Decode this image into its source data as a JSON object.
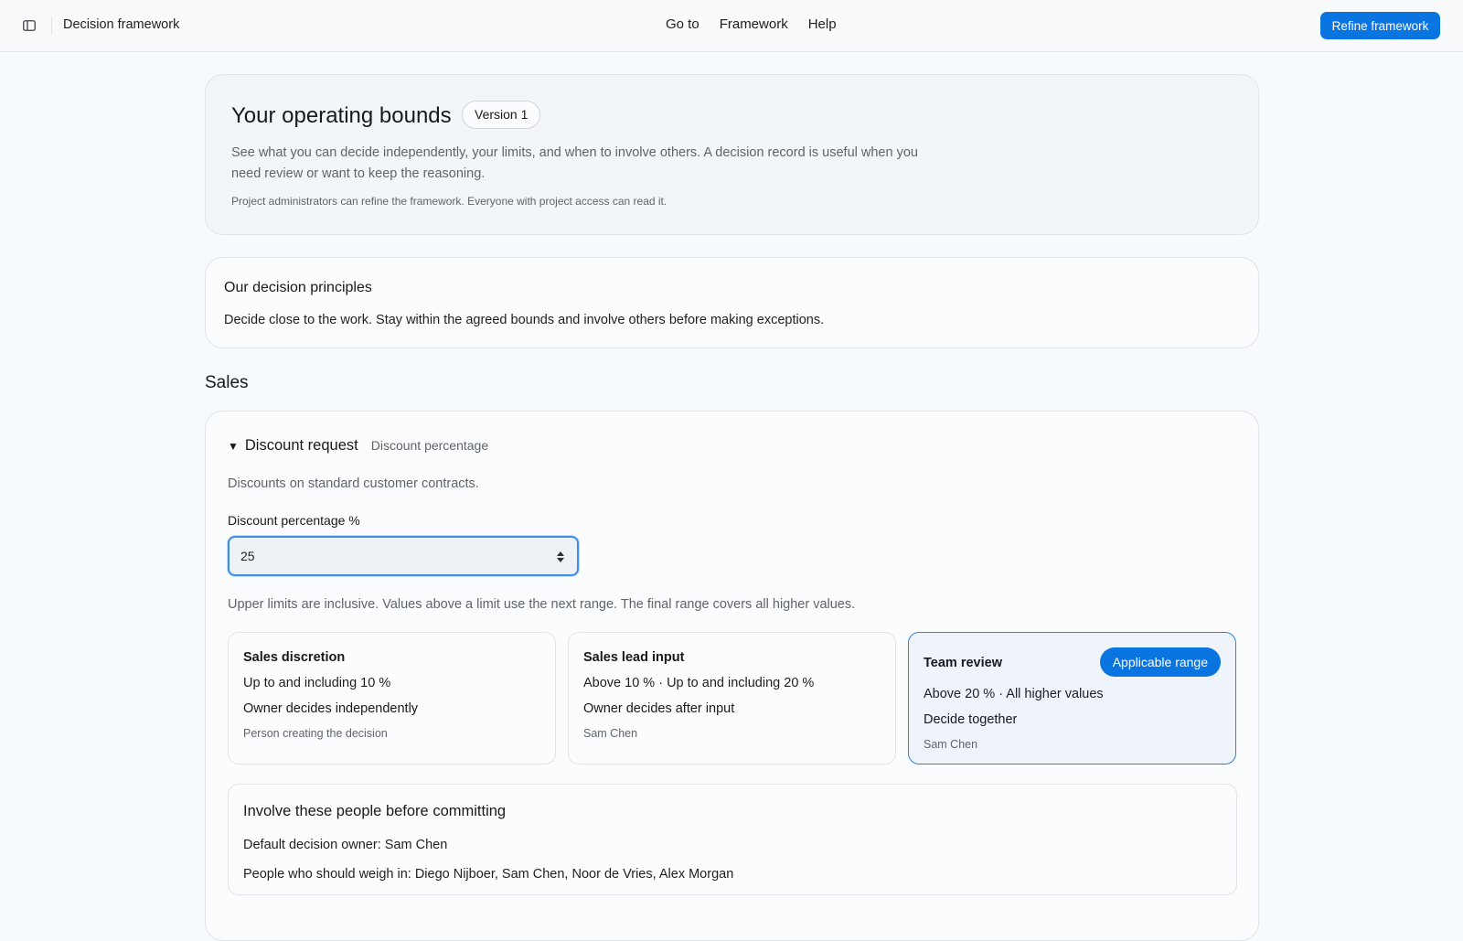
{
  "header": {
    "title": "Decision framework",
    "nav": [
      "Go to",
      "Framework",
      "Help"
    ],
    "refine_button": "Refine framework"
  },
  "hero": {
    "title": "Your operating bounds",
    "version": "Version 1",
    "description": "See what you can decide independently, your limits, and when to involve others. A decision record is useful when you need review or want to keep the reasoning.",
    "note": "Project administrators can refine the framework. Everyone with project access can read it."
  },
  "principles": {
    "title": "Our decision principles",
    "text": "Decide close to the work. Stay within the agreed bounds and involve others before making exceptions."
  },
  "section": {
    "title": "Sales",
    "request": {
      "title": "Discount request",
      "subtitle": "Discount percentage",
      "description": "Discounts on standard customer contracts.",
      "field_label": "Discount percentage %",
      "field_value": "25",
      "range_note": "Upper limits are inclusive. Values above a limit use the next range. The final range covers all higher values.",
      "ranges": [
        {
          "title": "Sales discretion",
          "range": "Up to and including 10 %",
          "mode": "Owner decides independently",
          "person": "Person creating the decision"
        },
        {
          "title": "Sales lead input",
          "range": "Above 10 % · Up to and including 20 %",
          "mode": "Owner decides after input",
          "person": "Sam Chen"
        },
        {
          "title": "Team review",
          "badge": "Applicable range",
          "range": "Above 20 % · All higher values",
          "mode": "Decide together",
          "person": "Sam Chen"
        }
      ],
      "people": {
        "title": "Involve these people before committing",
        "owner": "Default decision owner: Sam Chen",
        "weigh_in": "People who should weigh in: Diego Nijboer, Sam Chen, Noor de Vries, Alex Morgan"
      }
    }
  },
  "colors": {
    "accent": "#0a74e0",
    "background": "#f7fafd",
    "muted_text": "#5e646c",
    "active_border": "#2a82db"
  }
}
